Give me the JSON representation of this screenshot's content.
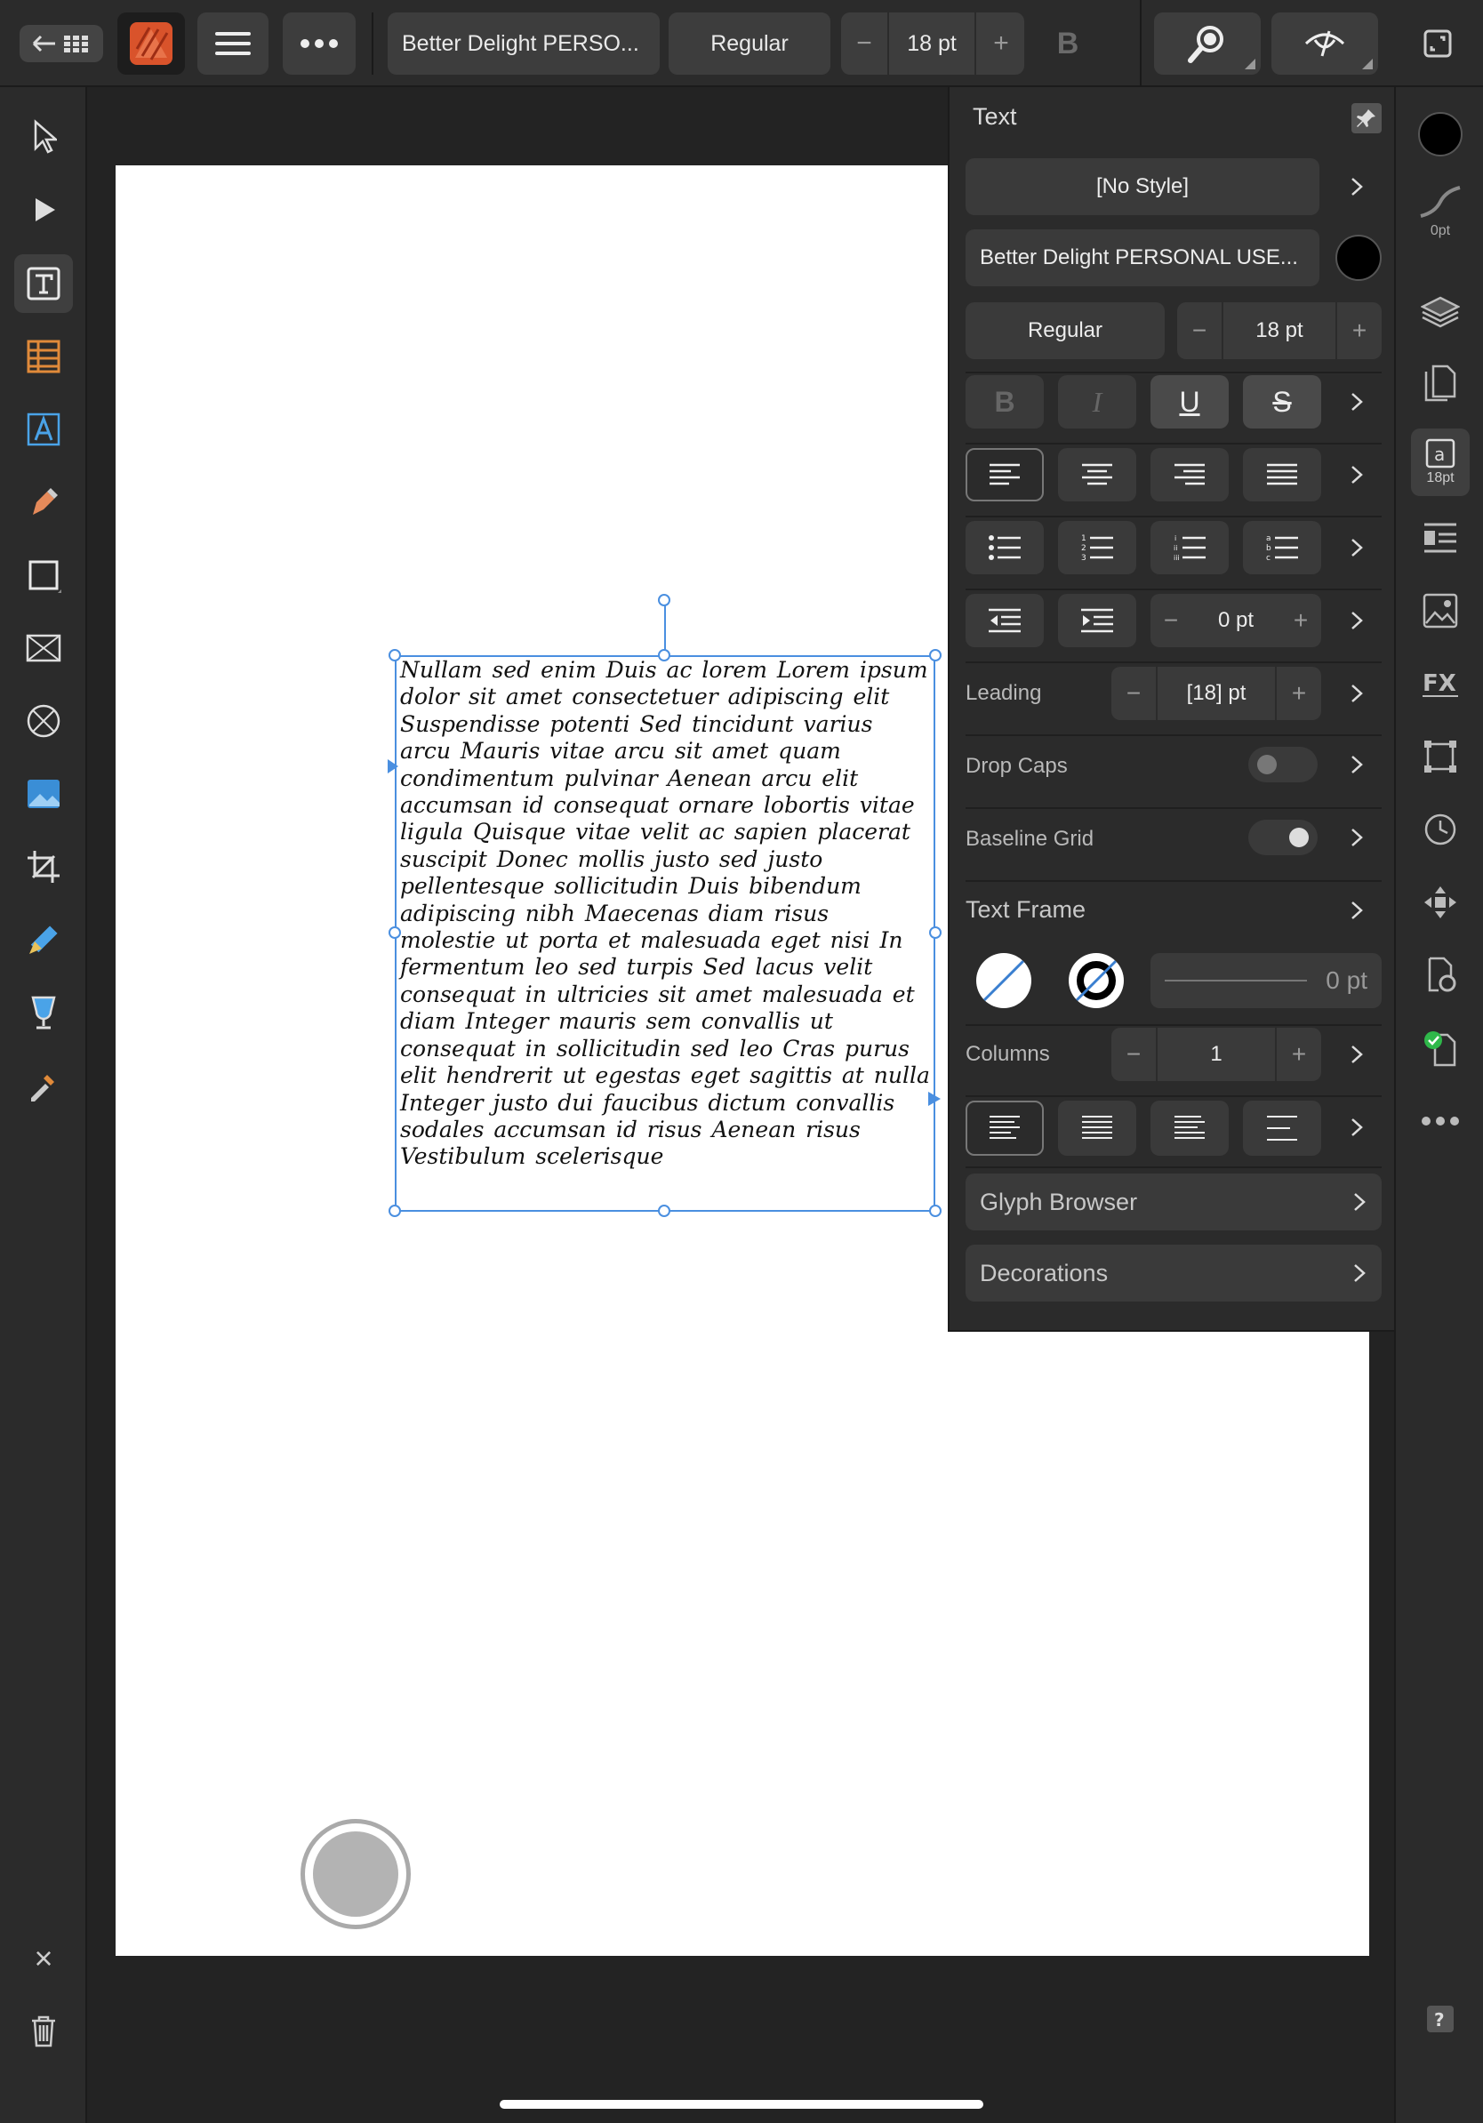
{
  "toolbar": {
    "back_icon": "back-grid-icon",
    "app_icon": "affinity-publisher-icon",
    "menu_icon": "hamburger-icon",
    "more_icon": "more-icon",
    "font_name": "Better Delight PERSO...",
    "font_style": "Regular",
    "font_size": "18 pt",
    "minus": "−",
    "plus": "+",
    "bold_label": "B"
  },
  "left_tools": [
    "move-tool-icon",
    "node-tool-icon",
    "frame-text-tool-icon",
    "table-tool-icon",
    "artistic-text-tool-icon",
    "pen-tool-icon",
    "rectangle-tool-icon",
    "picture-frame-icon",
    "ellipse-frame-icon",
    "place-image-icon",
    "crop-tool-icon",
    "pencil-ruler-icon",
    "vector-flood-icon",
    "color-picker-icon"
  ],
  "left_bottom": {
    "close": "×",
    "delete": "trash-icon"
  },
  "right_bar": {
    "stroke_size": "0pt",
    "text_size_badge": "18pt",
    "icons": [
      "color-swatch-icon",
      "stroke-icon",
      "layers-icon",
      "pages-icon",
      "text-studio-icon",
      "text-styles-icon",
      "assets-icon",
      "fx-icon",
      "transform-icon",
      "history-icon",
      "navigator-icon",
      "preflight-settings-icon",
      "preflight-check-icon",
      "more-icon",
      "help-icon"
    ]
  },
  "panel": {
    "title": "Text",
    "style": "[No Style]",
    "font": "Better Delight PERSONAL USE...",
    "font_style": "Regular",
    "size": "18 pt",
    "indent": "0 pt",
    "leading_label": "Leading",
    "leading_value": "[18] pt",
    "drop_caps": "Drop Caps",
    "drop_caps_on": false,
    "baseline_grid": "Baseline Grid",
    "baseline_grid_on": false,
    "text_frame": "Text Frame",
    "stroke_value": "0 pt",
    "columns_label": "Columns",
    "columns_value": "1",
    "glyph_browser": "Glyph Browser",
    "decorations": "Decorations",
    "bold": "B",
    "italic": "I",
    "underline": "U",
    "strike": "S",
    "accent": "#000000"
  },
  "frame_text": "Nullam sed enim Duis ac lorem Lorem ipsum dolor sit amet consectetuer adipiscing elit Suspendisse potenti Sed tincidunt varius arcu Mauris vitae arcu sit amet quam condimentum pulvinar Aenean arcu elit accumsan id consequat ornare lobortis vitae ligula Quisque vitae velit ac sapien placerat suscipit Donec mollis justo sed justo pellentesque sollicitudin Duis bibendum adipiscing nibh Maecenas diam risus molestie ut porta et malesuada eget nisi In fermentum leo sed turpis Sed lacus velit consequat in ultricies sit amet malesuada et diam Integer mauris sem convallis ut consequat in sollicitudin sed leo Cras purus elit hendrerit ut egestas eget sagittis at nulla Integer justo dui faucibus dictum convallis sodales accumsan id risus Aenean risus Vestibulum scelerisque"
}
